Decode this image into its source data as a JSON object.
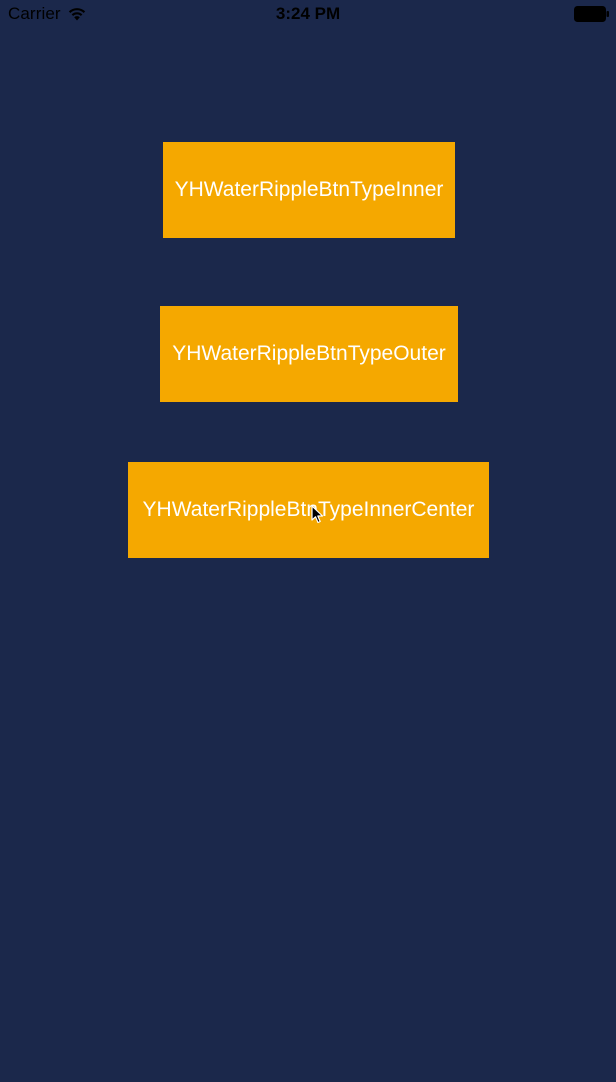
{
  "status_bar": {
    "carrier": "Carrier",
    "time": "3:24 PM",
    "wifi_icon": "wifi-icon",
    "battery_icon": "battery-icon"
  },
  "buttons": [
    {
      "label": "YHWaterRippleBtnTypeInner"
    },
    {
      "label": "YHWaterRippleBtnTypeOuter"
    },
    {
      "label": "YHWaterRippleBtnTypeInnerCenter"
    }
  ],
  "colors": {
    "background": "#1b284b",
    "button": "#f5a800",
    "button_text": "#ffffff"
  },
  "cursor_icon": "mouse-pointer-icon"
}
